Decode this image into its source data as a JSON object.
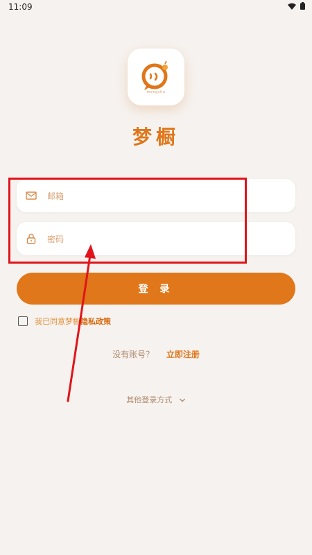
{
  "status_bar": {
    "time": "11:09"
  },
  "app": {
    "name": "梦橱",
    "logo_caption": "mengchu"
  },
  "form": {
    "email_placeholder": "邮箱",
    "password_placeholder": "密码",
    "login_label": "登 录"
  },
  "agreement": {
    "prefix": "我已同意梦橱",
    "link": "隐私政策",
    "checked": false
  },
  "register": {
    "question": "没有账号？",
    "link": "立即注册"
  },
  "other_login": {
    "label": "其他登录方式"
  },
  "colors": {
    "accent": "#e0771a",
    "background": "#f6f2ef",
    "annotation": "#e0141a"
  }
}
